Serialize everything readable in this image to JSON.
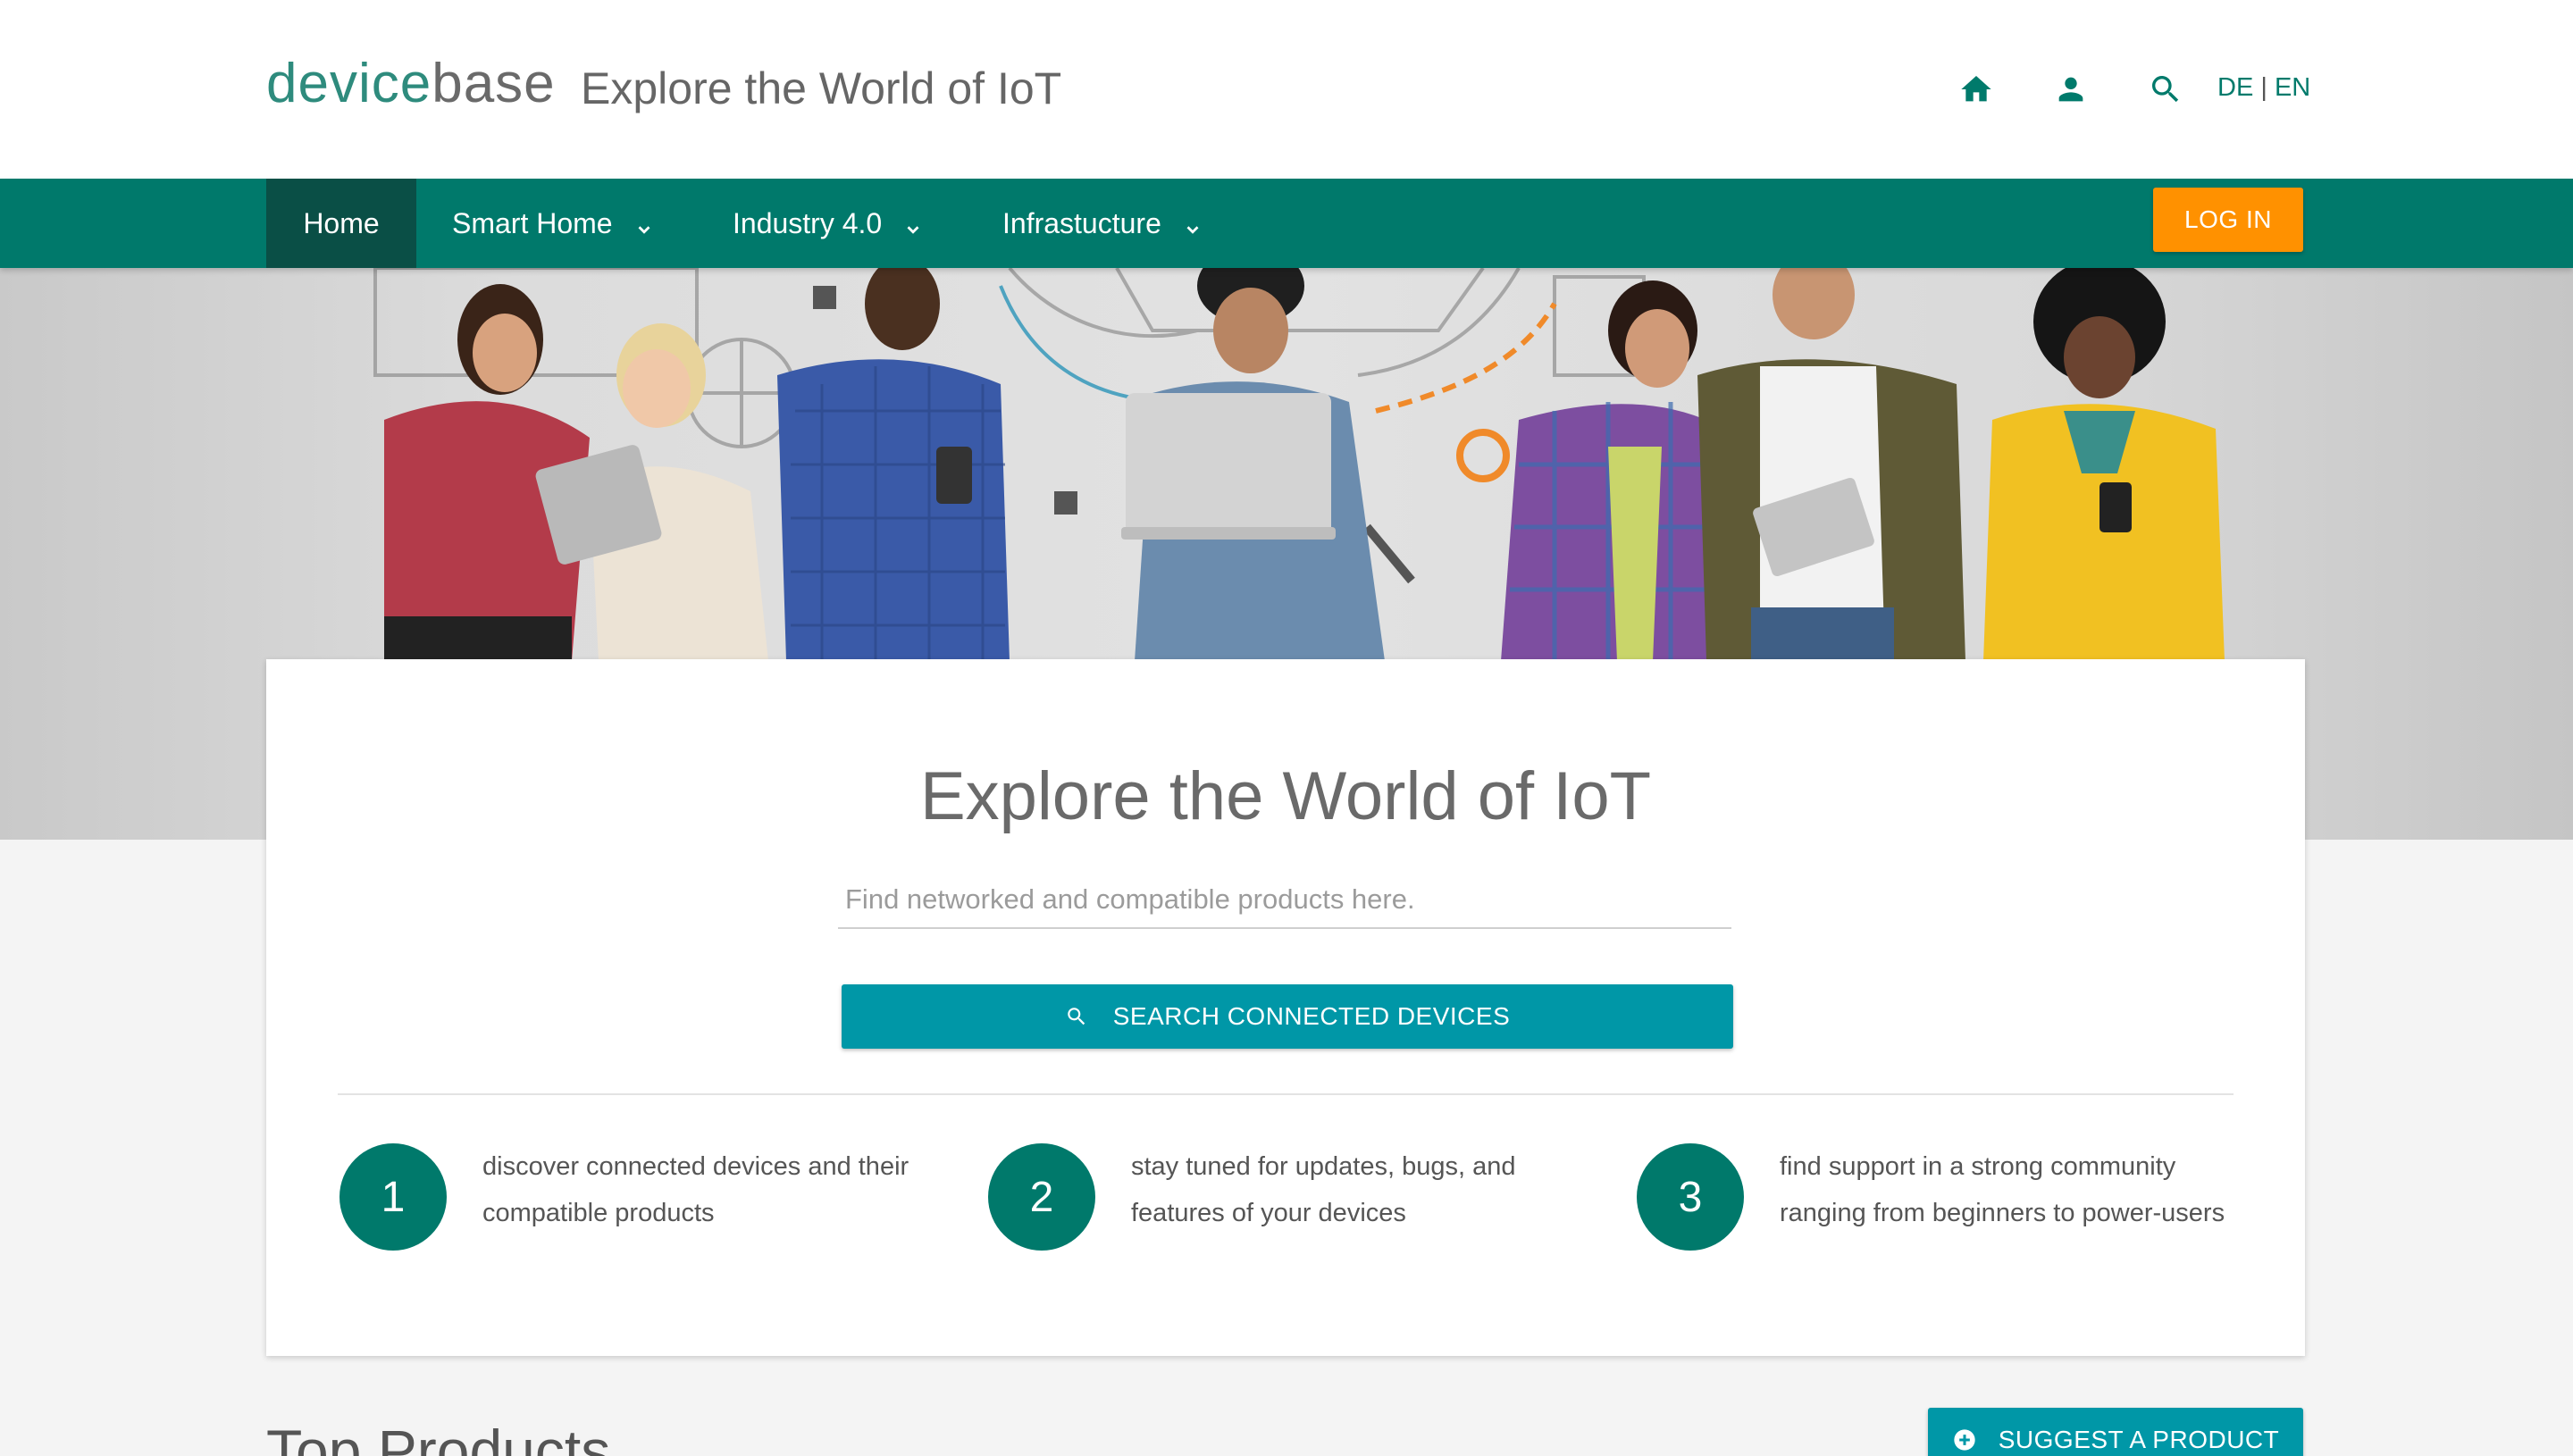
{
  "header": {
    "logo_part1": "device",
    "logo_part2": "base",
    "tagline": "Explore the World of IoT",
    "icons": [
      "home-icon",
      "account-icon",
      "search-icon"
    ],
    "lang_de": "DE",
    "lang_sep": "|",
    "lang_en": "EN"
  },
  "nav": {
    "items": [
      {
        "label": "Home",
        "active": true
      },
      {
        "label": "Smart Home",
        "dropdown": true
      },
      {
        "label": "Industry 4.0",
        "dropdown": true
      },
      {
        "label": "Infrastucture",
        "dropdown": true
      }
    ],
    "login_label": "LOG IN"
  },
  "hero": {
    "image": "hero-people-with-devices-illustration"
  },
  "card": {
    "title": "Explore the World of IoT",
    "search_placeholder": "Find networked and compatible products here.",
    "search_button": "SEARCH CONNECTED DEVICES",
    "steps": [
      {
        "number": "1",
        "text": "discover connected devices and their compatible products"
      },
      {
        "number": "2",
        "text": "stay tuned for updates, bugs, and features of your devices"
      },
      {
        "number": "3",
        "text": "find support in a strong community ranging from beginners to power-users"
      }
    ]
  },
  "bottom": {
    "section_title": "Top Products",
    "suggest_button": "SUGGEST A PRODUCT"
  },
  "colors": {
    "primary": "#00796b",
    "primary_dark": "#0a4f46",
    "accent": "#ff9100",
    "button": "#0097a7",
    "background": "#f4f4f4"
  }
}
